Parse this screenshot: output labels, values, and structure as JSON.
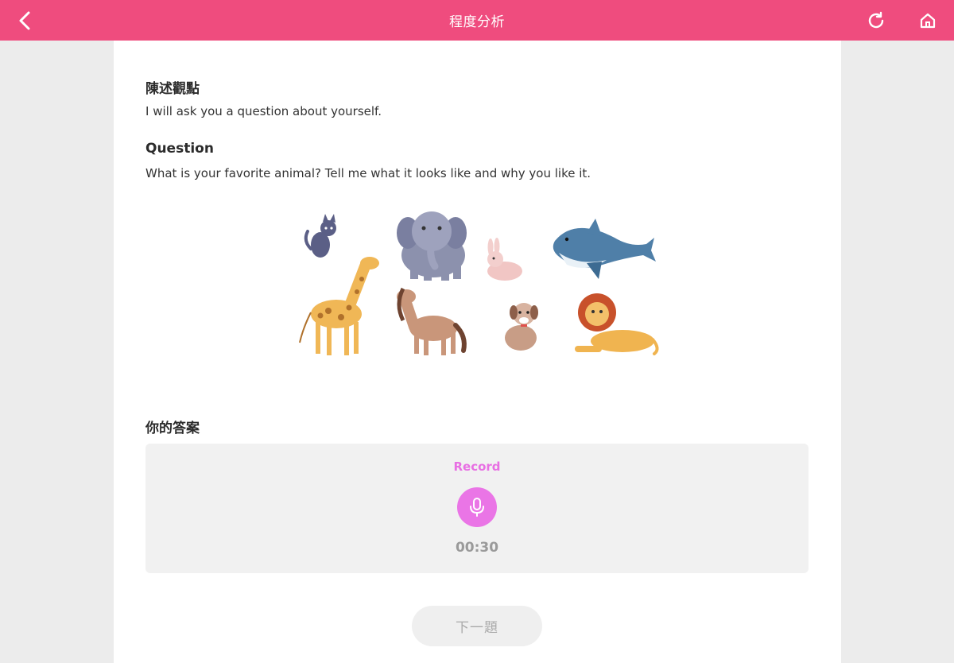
{
  "header": {
    "title": "程度分析",
    "back_icon": "chevron-left-icon",
    "refresh_icon": "refresh-icon",
    "home_icon": "home-icon"
  },
  "content": {
    "prompt_heading": "陳述觀點",
    "prompt_text": "I will ask you a question about yourself.",
    "question_heading": "Question",
    "question_text": "What is your favorite animal? Tell me what it looks like and why you like it.",
    "animals": [
      "cat",
      "elephant",
      "rabbit",
      "shark",
      "giraffe",
      "horse",
      "dog",
      "lion"
    ]
  },
  "answer": {
    "heading": "你的答案",
    "record_label": "Record",
    "mic_icon": "microphone-icon",
    "timer": "00:30"
  },
  "footer": {
    "next_label": "下一題"
  },
  "colors": {
    "header_bg": "#ef4c7e",
    "accent": "#ea75e6",
    "page_bg": "#ececec"
  }
}
